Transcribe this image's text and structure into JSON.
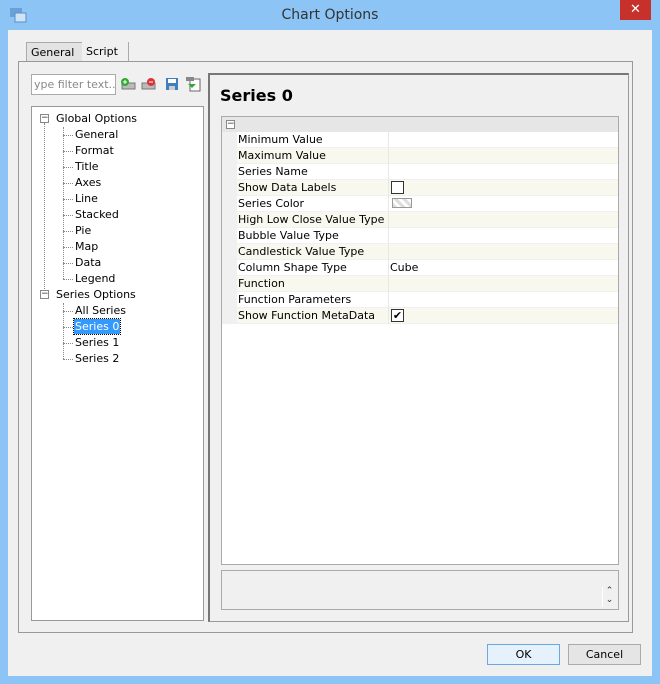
{
  "window": {
    "title": "Chart Options",
    "close_label": "✕"
  },
  "tabs": [
    {
      "label": "General",
      "active": true
    },
    {
      "label": "Script",
      "active": false
    }
  ],
  "filter": {
    "placeholder": "ype filter text..."
  },
  "toolbar": {
    "icons": [
      "add-icon",
      "remove-icon",
      "save-icon",
      "import-icon"
    ]
  },
  "tree": {
    "global": {
      "label": "Global Options",
      "children": [
        "General",
        "Format",
        "Title",
        "Axes",
        "Line",
        "Stacked",
        "Pie",
        "Map",
        "Data",
        "Legend"
      ]
    },
    "series": {
      "label": "Series Options",
      "children": [
        "All Series",
        "Series 0",
        "Series 1",
        "Series 2"
      ],
      "selected": "Series 0"
    }
  },
  "main": {
    "title": "Series 0",
    "properties": [
      {
        "label": "Minimum Value",
        "value": ""
      },
      {
        "label": "Maximum Value",
        "value": ""
      },
      {
        "label": "Series Name",
        "value": ""
      },
      {
        "label": "Show Data Labels",
        "type": "checkbox",
        "checked": false
      },
      {
        "label": "Series Color",
        "type": "color"
      },
      {
        "label": "High Low Close Value Type",
        "value": ""
      },
      {
        "label": "Bubble Value Type",
        "value": ""
      },
      {
        "label": "Candlestick Value Type",
        "value": ""
      },
      {
        "label": "Column Shape Type",
        "value": "Cube"
      },
      {
        "label": "Function",
        "value": ""
      },
      {
        "label": "Function Parameters",
        "value": ""
      },
      {
        "label": "Show Function MetaData",
        "type": "checkbox",
        "checked": true
      }
    ]
  },
  "buttons": {
    "ok": "OK",
    "cancel": "Cancel"
  }
}
